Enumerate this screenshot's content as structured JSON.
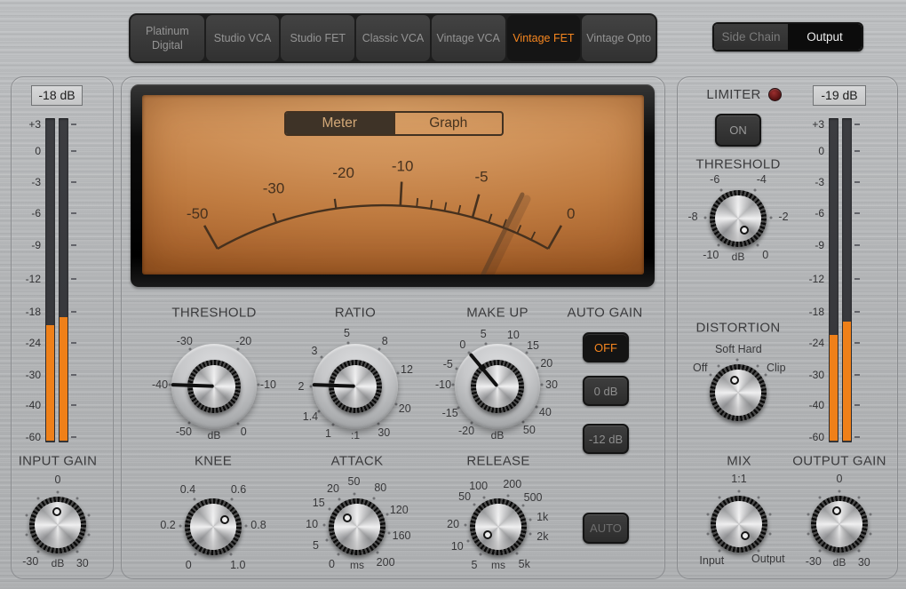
{
  "colors": {
    "accent": "#f6861f",
    "meter_fill": "#ef8019",
    "vu_ink": "#46311e",
    "led_red": "#7a1d1d"
  },
  "model_tabs": {
    "items": [
      {
        "label": "Platinum Digital",
        "selected": false
      },
      {
        "label": "Studio VCA",
        "selected": false
      },
      {
        "label": "Studio FET",
        "selected": false
      },
      {
        "label": "Classic VCA",
        "selected": false
      },
      {
        "label": "Vintage VCA",
        "selected": false
      },
      {
        "label": "Vintage FET",
        "selected": true
      },
      {
        "label": "Vintage Opto",
        "selected": false
      }
    ]
  },
  "view_switch": {
    "side_chain": "Side Chain",
    "output": "Output",
    "selected": "Output"
  },
  "input_meter": {
    "readout": "-18 dB",
    "scale": [
      "+3",
      "0",
      "-3",
      "-6",
      "-9",
      "-12",
      "-18",
      "-24",
      "-30",
      "-40",
      "-60"
    ],
    "fills_pct": [
      36,
      38.5
    ]
  },
  "output_meter": {
    "readout": "-19 dB",
    "scale": [
      "+3",
      "0",
      "-3",
      "-6",
      "-9",
      "-12",
      "-18",
      "-24",
      "-30",
      "-40",
      "-60"
    ],
    "fills_pct": [
      33,
      37
    ]
  },
  "vu": {
    "tabs": [
      {
        "label": "Meter",
        "selected": true
      },
      {
        "label": "Graph",
        "selected": false
      }
    ],
    "scale": [
      {
        "t": "-50",
        "a": -29.5,
        "kind": "end"
      },
      {
        "t": "-30",
        "a": -18.5,
        "kind": "normal"
      },
      {
        "t": "-20",
        "a": -8,
        "kind": "normal"
      },
      {
        "t": "-10",
        "a": 3,
        "kind": "major"
      },
      {
        "t": "-5",
        "a": 15.5,
        "kind": "major"
      },
      {
        "t": "0",
        "a": 29.5,
        "kind": "end"
      }
    ],
    "minor_ticks": [
      5.8,
      8.2,
      10.6,
      13,
      18.4,
      21,
      23.6,
      26.2
    ]
  },
  "knobs": {
    "threshold": {
      "label": "THRESHOLD",
      "unit": "dB",
      "indicator": -88,
      "ticks": [
        {
          "t": "-50",
          "a": -146
        },
        {
          "t": "-40",
          "a": -88
        },
        {
          "t": "-30",
          "a": -33
        },
        {
          "t": "-20",
          "a": 33
        },
        {
          "t": "-10",
          "a": 88
        },
        {
          "t": "0",
          "a": 147
        }
      ]
    },
    "ratio": {
      "label": "RATIO",
      "unit": ":1",
      "indicator": -88,
      "ticks": [
        {
          "t": "1",
          "a": -150
        },
        {
          "t": "1.4",
          "a": -124
        },
        {
          "t": "2",
          "a": -90
        },
        {
          "t": "3",
          "a": -49
        },
        {
          "t": "5",
          "a": -9
        },
        {
          "t": "8",
          "a": 33
        },
        {
          "t": "12",
          "a": 72
        },
        {
          "t": "20",
          "a": 114
        },
        {
          "t": "30",
          "a": 148
        }
      ]
    },
    "make_up": {
      "label": "MAKE UP",
      "unit": "dB",
      "indicator": -40,
      "ticks": [
        {
          "t": "-20",
          "a": -145
        },
        {
          "t": "-15",
          "a": -119
        },
        {
          "t": "-10",
          "a": -88
        },
        {
          "t": "-5",
          "a": -66
        },
        {
          "t": "0",
          "a": -40
        },
        {
          "t": "5",
          "a": -15
        },
        {
          "t": "10",
          "a": 17
        },
        {
          "t": "15",
          "a": 41
        },
        {
          "t": "20",
          "a": 65
        },
        {
          "t": "30",
          "a": 88
        },
        {
          "t": "40",
          "a": 118
        },
        {
          "t": "50",
          "a": 144
        }
      ]
    },
    "knee": {
      "label": "KNEE",
      "indicator": 57,
      "ticks": [
        {
          "t": "0",
          "a": -147
        },
        {
          "t": "0.2",
          "a": -88
        },
        {
          "t": "0.4",
          "a": -34
        },
        {
          "t": "0.6",
          "a": 34
        },
        {
          "t": "0.8",
          "a": 88
        },
        {
          "t": "1.0",
          "a": 147
        }
      ]
    },
    "attack": {
      "label": "ATTACK",
      "unit": "ms",
      "indicator": -47,
      "ticks": [
        {
          "t": "0",
          "a": -146
        },
        {
          "t": "5",
          "a": -114
        },
        {
          "t": "10",
          "a": -87
        },
        {
          "t": "15",
          "a": -58
        },
        {
          "t": "20",
          "a": -32
        },
        {
          "t": "50",
          "a": -4
        },
        {
          "t": "80",
          "a": 31
        },
        {
          "t": "120",
          "a": 68
        },
        {
          "t": "160",
          "a": 101
        },
        {
          "t": "200",
          "a": 141
        }
      ]
    },
    "release": {
      "label": "RELEASE",
      "unit": "ms",
      "indicator": -129,
      "ticks": [
        {
          "t": "5",
          "a": -148
        },
        {
          "t": "10",
          "a": -115
        },
        {
          "t": "20",
          "a": -87
        },
        {
          "t": "50",
          "a": -48
        },
        {
          "t": "100",
          "a": -26
        },
        {
          "t": "200",
          "a": 18
        },
        {
          "t": "500",
          "a": 50
        },
        {
          "t": "1k",
          "a": 77
        },
        {
          "t": "2k",
          "a": 102
        },
        {
          "t": "5k",
          "a": 145
        }
      ]
    },
    "input_gain": {
      "label": "INPUT GAIN",
      "unit": "dB",
      "indicator": -2,
      "ticks": [
        {
          "t": "-30",
          "a": -143
        },
        {
          "t": "0",
          "a": 0
        },
        {
          "t": "30",
          "a": 147
        }
      ],
      "dots": [
        -144,
        -108,
        -72,
        -36,
        0,
        36,
        72,
        108,
        144
      ]
    },
    "limiter_threshold": {
      "label": "THRESHOLD",
      "unit": "dB",
      "indicator": 152,
      "ticks": [
        {
          "t": "-10",
          "a": -143
        },
        {
          "t": "-8",
          "a": -88
        },
        {
          "t": "-6",
          "a": -31
        },
        {
          "t": "-4",
          "a": 31
        },
        {
          "t": "-2",
          "a": 88
        },
        {
          "t": "0",
          "a": 143
        }
      ]
    },
    "distortion": {
      "label": "DISTORTION",
      "indicator": -16,
      "ticks": [
        {
          "t": "Off",
          "a": -57
        },
        {
          "t": "Soft",
          "a": -17
        },
        {
          "t": "Hard",
          "a": 15
        },
        {
          "t": "Clip",
          "a": 57
        }
      ],
      "dots": [
        -57,
        -37,
        -1,
        36,
        57
      ]
    },
    "mix": {
      "label": "MIX",
      "indicator": 152,
      "ticks": [
        {
          "t": "Input",
          "a": -143
        },
        {
          "t": "1:1",
          "a": 0
        },
        {
          "t": "Output",
          "a": 140
        }
      ],
      "dots": [
        -144,
        -108,
        -72,
        -36,
        0,
        36,
        72,
        108,
        144
      ]
    },
    "output_gain": {
      "label": "OUTPUT GAIN",
      "unit": "dB",
      "indicator": -12,
      "ticks": [
        {
          "t": "-30",
          "a": -145
        },
        {
          "t": "0",
          "a": 0
        },
        {
          "t": "30",
          "a": 147
        }
      ],
      "dots": [
        -144,
        -108,
        -72,
        -36,
        0,
        36,
        72,
        108,
        144
      ]
    }
  },
  "auto_gain": {
    "label": "AUTO GAIN",
    "options": [
      {
        "label": "OFF",
        "selected": true
      },
      {
        "label": "0 dB",
        "selected": false
      },
      {
        "label": "-12 dB",
        "selected": false
      }
    ]
  },
  "auto_button": {
    "label": "AUTO"
  },
  "limiter": {
    "label": "LIMITER",
    "on_label": "ON"
  }
}
